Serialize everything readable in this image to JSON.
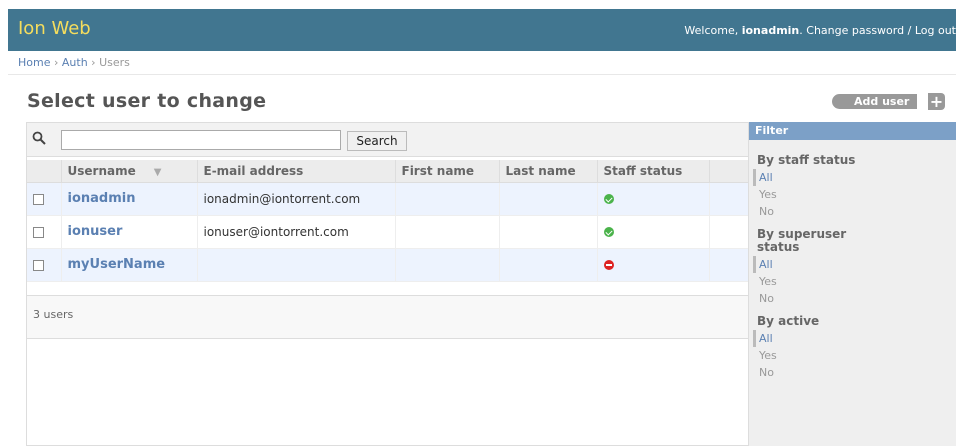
{
  "header": {
    "brand": "Ion Web",
    "welcome": "Welcome,",
    "username": "ionadmin",
    "change_password": "Change password",
    "separator": "/",
    "logout": "Log out"
  },
  "breadcrumbs": {
    "home": "Home",
    "auth": "Auth",
    "users": "Users",
    "sep": "›"
  },
  "page_title": "Select user to change",
  "add_user": "Add user",
  "search": {
    "value": "",
    "button": "Search"
  },
  "table": {
    "columns": [
      "Username",
      "E-mail address",
      "First name",
      "Last name",
      "Staff status"
    ],
    "rows": [
      {
        "username": "ionadmin",
        "email": "ionadmin@iontorrent.com",
        "first_name": "",
        "last_name": "",
        "staff": "yes"
      },
      {
        "username": "ionuser",
        "email": "ionuser@iontorrent.com",
        "first_name": "",
        "last_name": "",
        "staff": "yes"
      },
      {
        "username": "myUserName",
        "email": "",
        "first_name": "",
        "last_name": "",
        "staff": "no"
      }
    ]
  },
  "paginator": "3 users",
  "filter": {
    "title": "Filter",
    "groups": [
      {
        "title": "By staff status",
        "options": [
          "All",
          "Yes",
          "No"
        ]
      },
      {
        "title": "By superuser status",
        "options": [
          "All",
          "Yes",
          "No"
        ]
      },
      {
        "title": "By active",
        "options": [
          "All",
          "Yes",
          "No"
        ]
      }
    ]
  },
  "colors": {
    "header_bg": "#417690",
    "brand": "#f5dd5d",
    "link": "#5b80b2",
    "filter_title_bg": "#7ca0c7",
    "staff_yes": "#4bb34b",
    "staff_no": "#dd2222"
  },
  "icons": {
    "search": "search-icon",
    "add": "plus-icon",
    "sort": "sort-desc-icon",
    "staff_yes": "check-circle-icon",
    "staff_no": "minus-circle-icon"
  }
}
